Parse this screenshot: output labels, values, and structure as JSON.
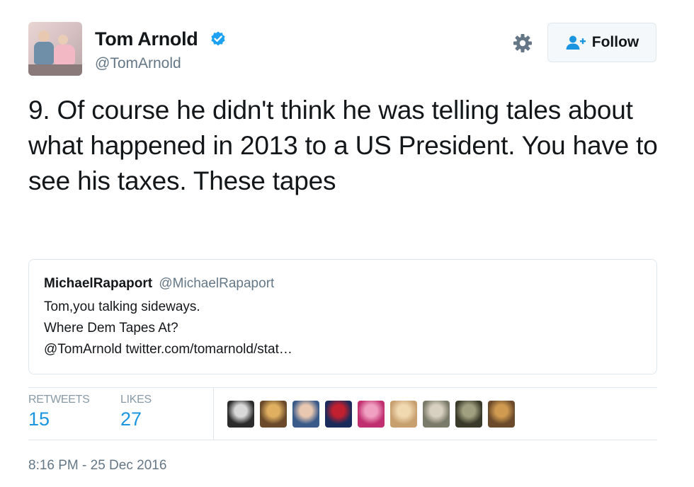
{
  "author": {
    "display_name": "Tom Arnold",
    "handle": "@TomArnold"
  },
  "header": {
    "follow_label": "Follow"
  },
  "tweet": {
    "text": "9. Of course he didn't think he was telling tales about what happened in 2013 to a US President. You have to see his taxes. These tapes"
  },
  "quoted": {
    "name": "MichaelRapaport",
    "handle": "@MichaelRapaport",
    "lines": [
      "Tom,you talking sideways.",
      "Where Dem Tapes At?",
      "@TomArnold twitter.com/tomarnold/stat…"
    ]
  },
  "stats": {
    "retweets_label": "RETWEETS",
    "retweets_count": "15",
    "likes_label": "LIKES",
    "likes_count": "27"
  },
  "liker_avatars": [
    {
      "name": "liker-avatar-1",
      "colors": [
        "#2b2b2b",
        "#d9d9d9"
      ]
    },
    {
      "name": "liker-avatar-2",
      "colors": [
        "#6a4a2a",
        "#e0b060"
      ]
    },
    {
      "name": "liker-avatar-3",
      "colors": [
        "#3a5a8a",
        "#e8c8b0"
      ]
    },
    {
      "name": "liker-avatar-4",
      "colors": [
        "#1a2a5a",
        "#c02030"
      ]
    },
    {
      "name": "liker-avatar-5",
      "colors": [
        "#c03070",
        "#f0a0c0"
      ]
    },
    {
      "name": "liker-avatar-6",
      "colors": [
        "#c8a070",
        "#f0d8b0"
      ]
    },
    {
      "name": "liker-avatar-7",
      "colors": [
        "#7a7a6a",
        "#d8d0c0"
      ]
    },
    {
      "name": "liker-avatar-8",
      "colors": [
        "#3a3a2a",
        "#a0a080"
      ]
    },
    {
      "name": "liker-avatar-9",
      "colors": [
        "#6a4a2a",
        "#d09a50"
      ]
    }
  ],
  "timestamp": "8:16 PM - 25 Dec 2016",
  "colors": {
    "link_blue": "#1b95e0",
    "verified_blue": "#1da1f2",
    "muted_text": "#657786",
    "border": "#e1e8ed"
  },
  "icons": {
    "verified": "verified-badge-icon",
    "gear": "gear-icon",
    "follow": "add-user-icon"
  }
}
